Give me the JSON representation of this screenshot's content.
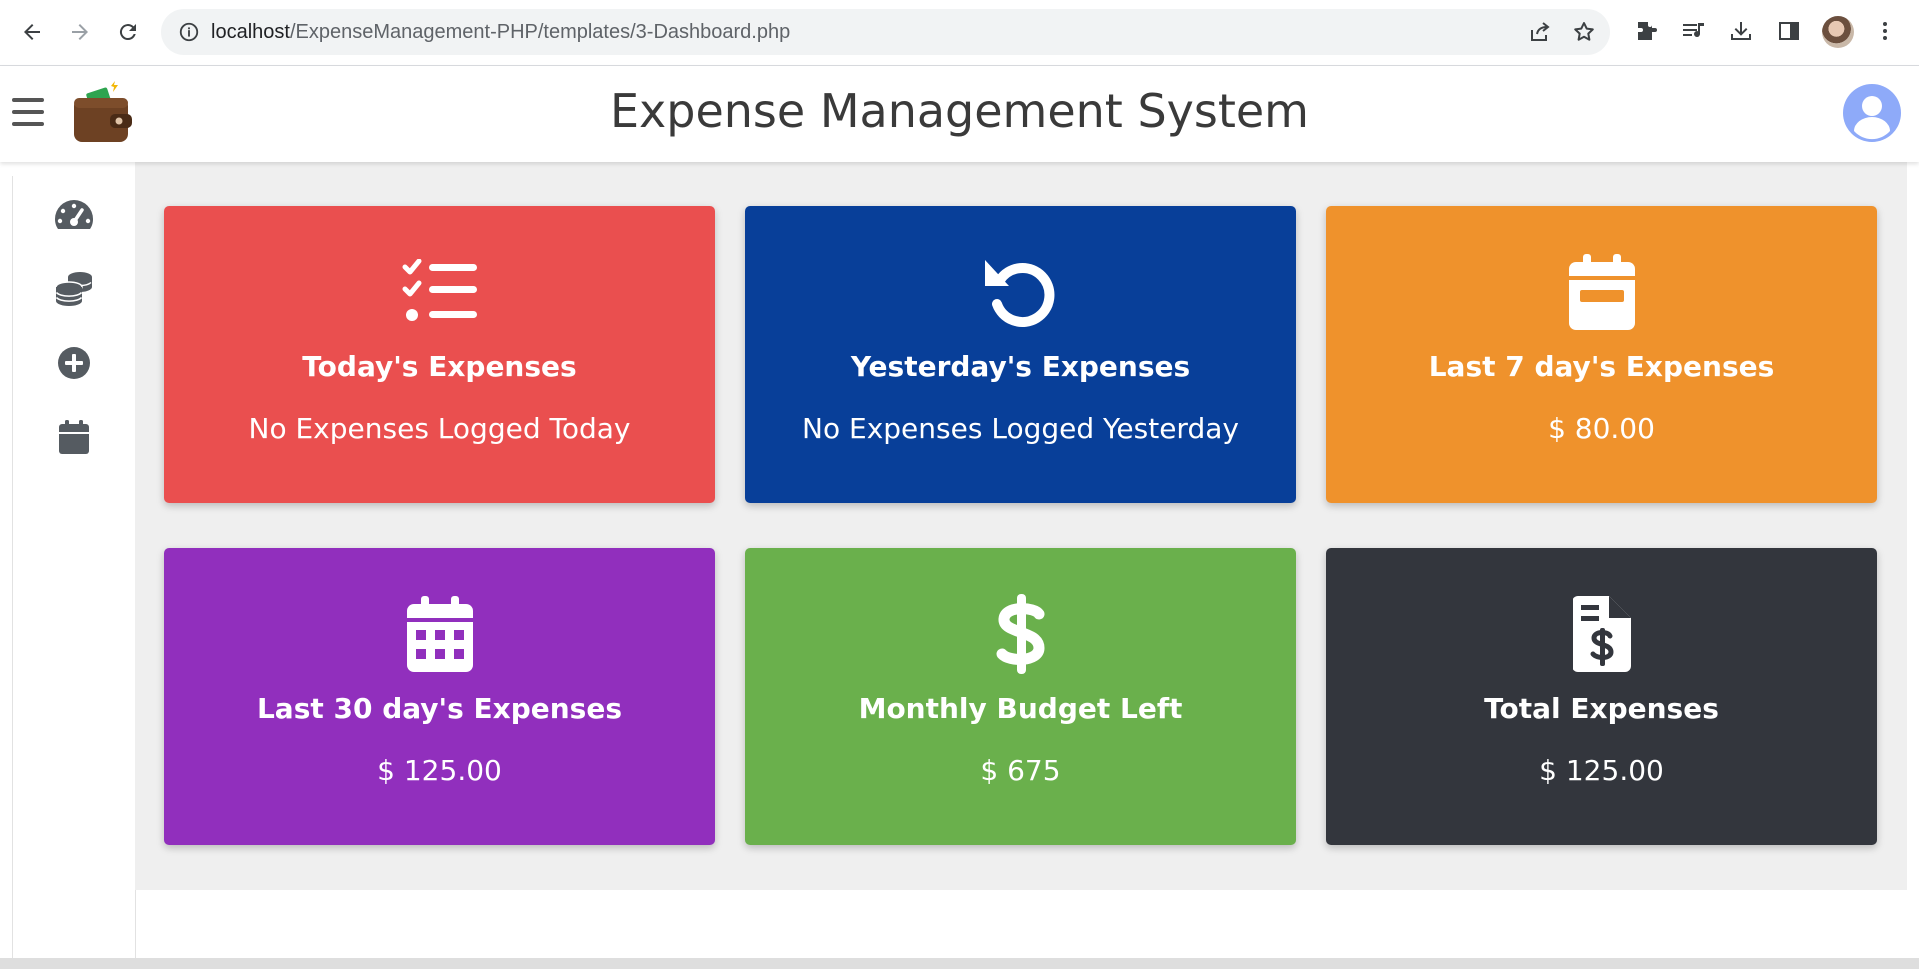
{
  "browser": {
    "url_host": "localhost",
    "url_path": "/ExpenseManagement-PHP/templates/3-Dashboard.php"
  },
  "app": {
    "title": "Expense Management System"
  },
  "sidebar": {
    "items": [
      {
        "icon": "gauge-icon",
        "label": "Dashboard"
      },
      {
        "icon": "coins-icon",
        "label": "Expenses"
      },
      {
        "icon": "plus-circle-icon",
        "label": "Add Expense"
      },
      {
        "icon": "calendar-icon",
        "label": "Calendar"
      }
    ]
  },
  "cards": [
    {
      "title": "Today's Expenses",
      "value": "No Expenses Logged Today",
      "color": "#ea4f4f",
      "icon": "list-check-icon"
    },
    {
      "title": "Yesterday's Expenses",
      "value": "No Expenses Logged Yesterday",
      "color": "#083f99",
      "icon": "rotate-left-icon"
    },
    {
      "title": "Last 7 day's Expenses",
      "value": "$ 80.00",
      "color": "#ef922c",
      "icon": "calendar-week-icon"
    },
    {
      "title": "Last 30 day's Expenses",
      "value": "$ 125.00",
      "color": "#912fbd",
      "icon": "calendar-days-icon"
    },
    {
      "title": "Monthly Budget Left",
      "value": "$ 675",
      "color": "#6ab04c",
      "icon": "dollar-sign-icon"
    },
    {
      "title": "Total Expenses",
      "value": "$ 125.00",
      "color": "#33363d",
      "icon": "file-invoice-dollar-icon"
    }
  ]
}
